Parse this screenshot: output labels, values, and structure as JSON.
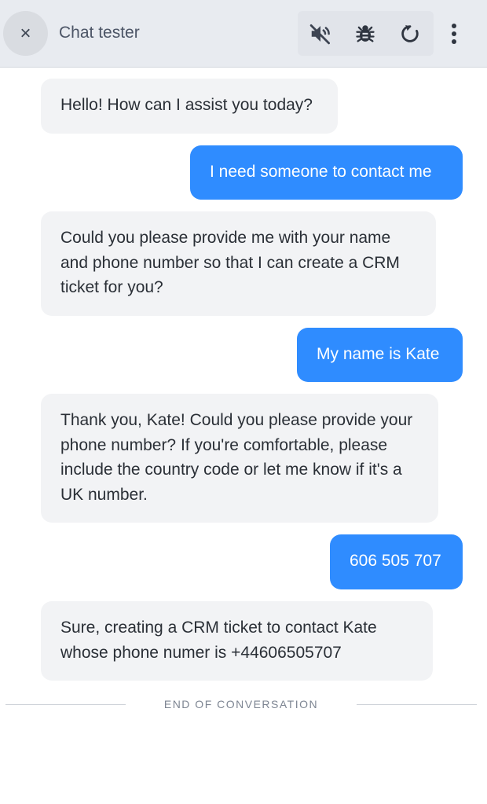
{
  "header": {
    "close_label": "×",
    "title": "Chat tester"
  },
  "toolbar": {
    "icons": [
      "volume-muted-icon",
      "bug-icon",
      "refresh-icon"
    ],
    "menu_icon": "more-vertical-icon"
  },
  "messages": [
    {
      "role": "bot",
      "text": "Hello! How can I assist you today?"
    },
    {
      "role": "user",
      "text": "I need someone to contact me"
    },
    {
      "role": "bot",
      "text": "Could you please provide me with your name and phone number so that I can create a CRM ticket for you?"
    },
    {
      "role": "user",
      "text": "My name is Kate"
    },
    {
      "role": "bot",
      "text": "Thank you, Kate! Could you please provide your phone number? If you're comfortable, please include the country code or let me know if it's a UK number."
    },
    {
      "role": "user",
      "text": "606 505 707"
    },
    {
      "role": "bot",
      "text": "Sure, creating a CRM ticket to contact Kate whose phone numer is +44606505707"
    }
  ],
  "end_of_conversation": "END OF CONVERSATION",
  "colors": {
    "user_bubble": "#2f8cff",
    "bot_bubble": "#f2f3f5",
    "header_bg": "#e8ebf0"
  }
}
